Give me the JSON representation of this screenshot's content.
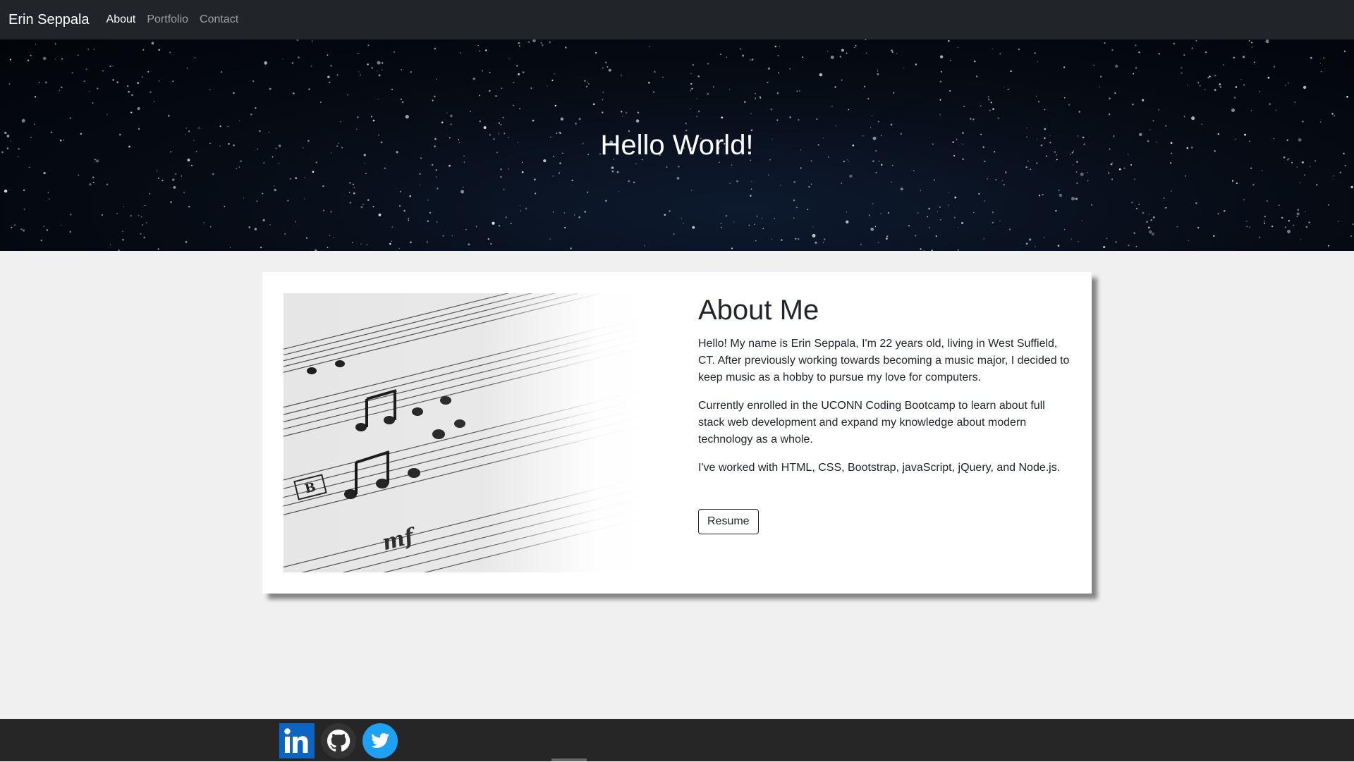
{
  "navbar": {
    "brand": "Erin Seppala",
    "links": [
      {
        "label": "About",
        "active": true
      },
      {
        "label": "Portfolio",
        "active": false
      },
      {
        "label": "Contact",
        "active": false
      }
    ]
  },
  "hero": {
    "title": "Hello World!"
  },
  "about": {
    "title": "About Me",
    "paragraphs": [
      "Hello! My name is Erin Seppala, I'm 22 years old, living in West Suffield, CT. After previously working towards becoming a music major, I decided to keep music as a hobby to pursue my love for computers.",
      "Currently enrolled in the UCONN Coding Bootcamp to learn about full stack web development and expand my knowledge about modern technology as a whole.",
      "I've worked with HTML, CSS, Bootstrap, javaScript, jQuery, and Node.js."
    ],
    "resume_label": "Resume",
    "image_icon": "sheet-music-image"
  },
  "footer": {
    "social": [
      {
        "icon": "linkedin-icon",
        "color": "#0a66c2"
      },
      {
        "icon": "github-icon",
        "color": "#333333"
      },
      {
        "icon": "twitter-icon",
        "color": "#1da1f2"
      }
    ]
  },
  "colors": {
    "navbar_bg": "#212529",
    "page_bg": "#f0f0f0",
    "footer_bg": "#262626"
  }
}
